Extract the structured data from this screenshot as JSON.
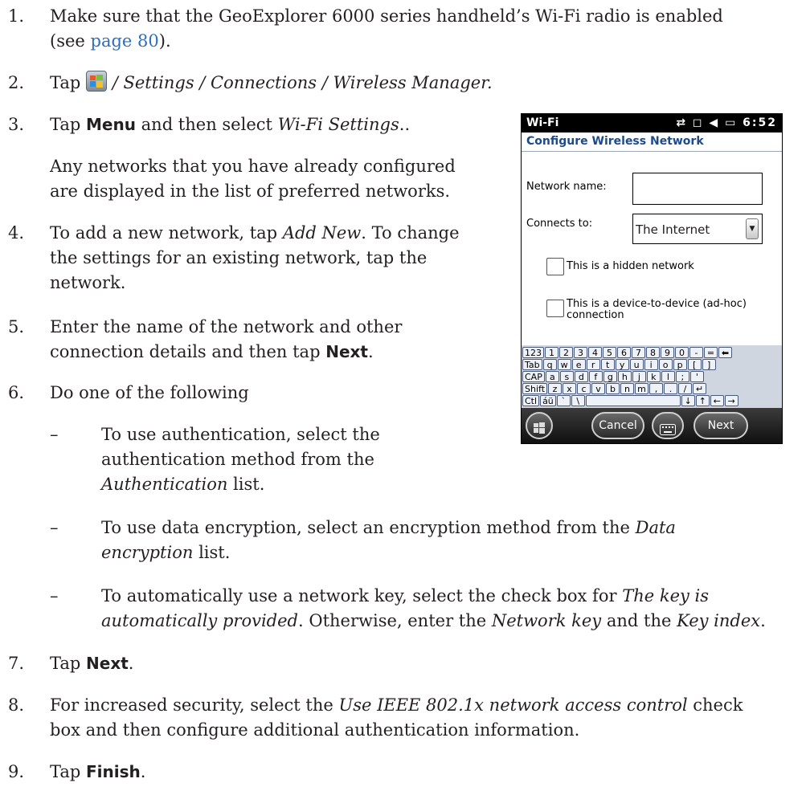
{
  "steps": [
    {
      "num": "1.",
      "line1": "Make sure that the GeoExplorer 6000 series handheld’s Wi-Fi radio is enabled",
      "line2_pre": "(see ",
      "line2_link": "page 80",
      "line2_post": ")."
    },
    {
      "num": "2.",
      "pre": "Tap",
      "path": " / Settings / Connections / Wireless Manager."
    },
    {
      "num": "3.",
      "pre": "Tap ",
      "cmd": "Menu",
      "mid": " and then select ",
      "it": "Wi-Fi Settings",
      "post": ".."
    },
    {
      "line1": "Any networks that you have already configured",
      "line2": "are displayed in the list of preferred networks."
    },
    {
      "num": "4.",
      "line1_pre": "To add a new network, tap ",
      "line1_it": "Add New",
      "line1_post": ". To change",
      "line2": "the settings for an existing network, tap the",
      "line3": "network."
    },
    {
      "num": "5.",
      "line1": "Enter the name of the network and other",
      "line2_pre": "connection details and then tap ",
      "line2_cmd": "Next",
      "line2_post": "."
    },
    {
      "num": "6.",
      "line1": "Do one of the following"
    },
    {
      "num": "7.",
      "pre": "Tap ",
      "cmd": "Next",
      "post": "."
    },
    {
      "num": "8.",
      "line1_pre": "For increased security, select the ",
      "line1_it": "Use IEEE 802.1x network access control",
      "line1_post": " check",
      "line2": "box and then configure additional authentication information."
    },
    {
      "num": "9.",
      "pre": "Tap ",
      "cmd": "Finish",
      "post": "."
    }
  ],
  "bullets": [
    {
      "dash": "–",
      "line1": "To use authentication, select the",
      "line2": "authentication method from the",
      "line3_it": "Authentication",
      "line3_post": " list."
    },
    {
      "dash": "–",
      "line1_pre": "To use data encryption, select an encryption method from the ",
      "line1_it": "Data",
      "line2_it": "encryption",
      "line2_post": " list."
    },
    {
      "dash": "–",
      "line1_pre": "To automatically use a network key, select the check box for ",
      "line1_it": "The key is",
      "line2_it": "automatically provided",
      "line2_mid": ". Otherwise, enter the ",
      "line2_it2": "Network key",
      "line2_mid2": " and the ",
      "line2_it3": "Key index",
      "line2_post": "."
    }
  ],
  "phone": {
    "title": "Wi-Fi",
    "status_icons": "⇄ ◻ ◀ ▭",
    "time": "6:52",
    "header": "Configure Wireless Network",
    "network_name_label": "Network name:",
    "network_name_value": "",
    "connects_to_label": "Connects to:",
    "connects_to_value": "The Internet",
    "hidden_label": "This is a hidden network",
    "adhoc_label_1": "This is a device-to-device (ad-hoc)",
    "adhoc_label_2": "connection",
    "keyboard": {
      "row1": [
        "123",
        "1",
        "2",
        "3",
        "4",
        "5",
        "6",
        "7",
        "8",
        "9",
        "0",
        "-",
        "=",
        "⬅"
      ],
      "row2": [
        "Tab",
        "q",
        "w",
        "e",
        "r",
        "t",
        "y",
        "u",
        "i",
        "o",
        "p",
        "[",
        "]"
      ],
      "row3": [
        "CAP",
        "a",
        "s",
        "d",
        "f",
        "g",
        "h",
        "j",
        "k",
        "l",
        ";",
        "'"
      ],
      "row4": [
        "Shift",
        "z",
        "x",
        "c",
        "v",
        "b",
        "n",
        "m",
        ",",
        ".",
        "/",
        "↵"
      ],
      "row5": [
        "Ctl",
        "áü",
        "`",
        "\\",
        " ",
        "↓",
        "↑",
        "←",
        "→"
      ]
    },
    "cancel": "Cancel",
    "next": "Next"
  }
}
